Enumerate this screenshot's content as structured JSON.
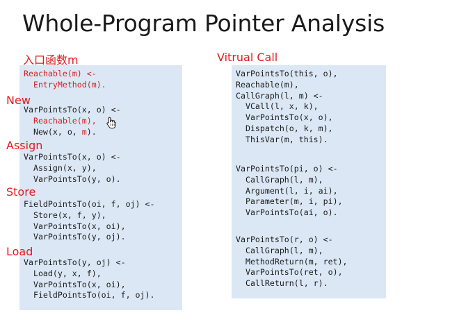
{
  "title": "Whole-Program Pointer Analysis",
  "labels": {
    "entry": "入口函数m",
    "new": "New",
    "assign": "Assign",
    "store": "Store",
    "load": "Load",
    "virtual_call": "Vitrual Call"
  },
  "left_code": {
    "entry": [
      "Reachable(m) <-",
      "  EntryMethod(m)."
    ],
    "new_head": "VarPointsTo(x, o) <-",
    "new_reachable": "  Reachable(m),",
    "new_body_pre": "  New(x, o, ",
    "new_body_m": "m",
    "new_body_post": ").",
    "assign": [
      "VarPointsTo(x, o) <-",
      "  Assign(x, y),",
      "  VarPointsTo(y, o)."
    ],
    "store": [
      "FieldPointsTo(oi, f, oj) <-",
      "  Store(x, f, y),",
      "  VarPointsTo(x, oi),",
      "  VarPointsTo(y, oj)."
    ],
    "load": [
      "VarPointsTo(y, oj) <-",
      "  Load(y, x, f),",
      "  VarPointsTo(x, oi),",
      "  FieldPointsTo(oi, f, oj)."
    ]
  },
  "right_code": {
    "vcall": [
      "VarPointsTo(this, o),",
      "Reachable(m),",
      "CallGraph(l, m) <-",
      "  VCall(l, x, k),",
      "  VarPointsTo(x, o),",
      "  Dispatch(o, k, m),",
      "  ThisVar(m, this)."
    ],
    "param": [
      "VarPointsTo(pi, o) <-",
      "  CallGraph(l, m),",
      "  Argument(l, i, ai),",
      "  Parameter(m, i, pi),",
      "  VarPointsTo(ai, o)."
    ],
    "ret": [
      "VarPointsTo(r, o) <-",
      "  CallGraph(l, m),",
      "  MethodReturn(m, ret),",
      "  VarPointsTo(ret, o),",
      "  CallReturn(l, r)."
    ]
  },
  "colors": {
    "accent_red": "#e01b1b",
    "panel_bg": "#dbe7f5"
  },
  "icons": {
    "cursor": "hand-pointer-icon"
  }
}
